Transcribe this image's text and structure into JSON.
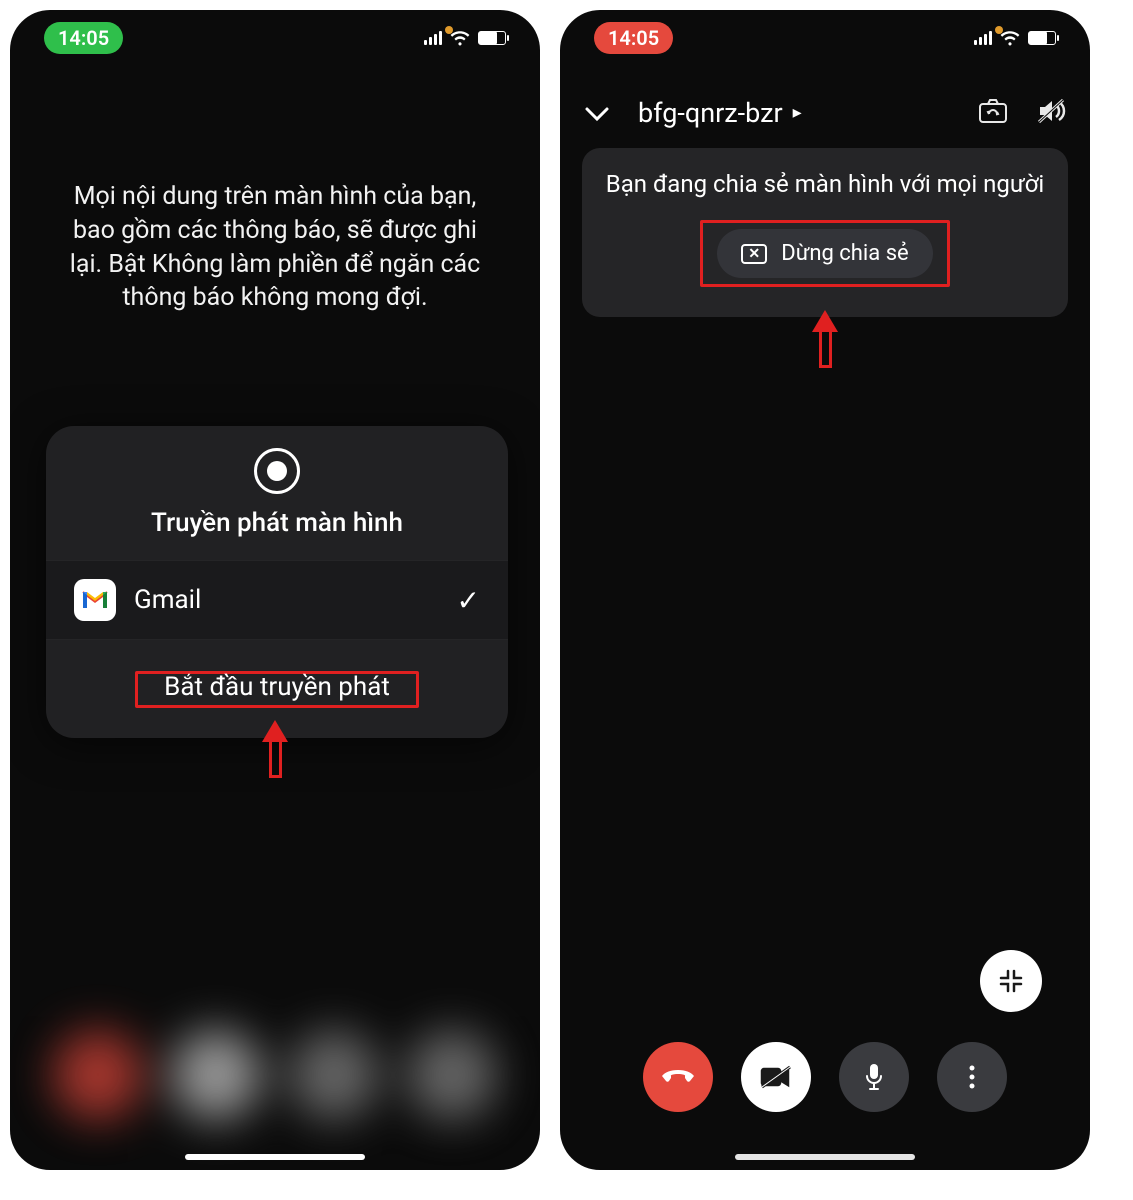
{
  "status": {
    "time": "14:05"
  },
  "screen1": {
    "warning": "Mọi nội dung trên màn hình của bạn, bao gồm các thông báo, sẽ được ghi lại. Bật Không làm phiền để ngăn các thông báo không mong đợi.",
    "sheet_title": "Truyền phát màn hình",
    "app_name": "Gmail",
    "start_label": "Bắt đầu truyền phát"
  },
  "screen2": {
    "meeting_code": "bfg-qnrz-bzr",
    "share_message": "Bạn đang chia sẻ màn hình với mọi người",
    "stop_label": "Dừng chia sẻ"
  }
}
